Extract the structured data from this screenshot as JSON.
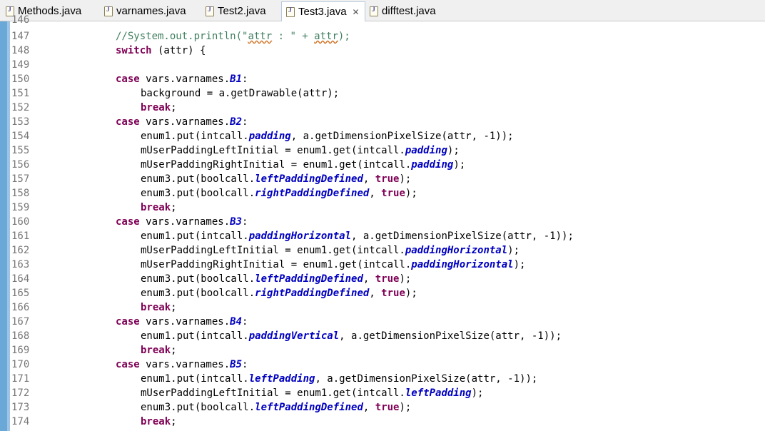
{
  "tabs": [
    {
      "label": "Methods.java",
      "active": false
    },
    {
      "label": "varnames.java",
      "active": false
    },
    {
      "label": "Test2.java",
      "active": false
    },
    {
      "label": "Test3.java",
      "active": true
    },
    {
      "label": "difftest.java",
      "active": false
    }
  ],
  "editor": {
    "first_line_partial": "146",
    "line_numbers": [
      "147",
      "148",
      "149",
      "150",
      "151",
      "152",
      "153",
      "154",
      "155",
      "156",
      "157",
      "158",
      "159",
      "160",
      "161",
      "162",
      "163",
      "164",
      "165",
      "166",
      "167",
      "168",
      "169",
      "170",
      "171",
      "172",
      "173",
      "174"
    ],
    "lines": {
      "l147": {
        "c": "//System.out.println(\"",
        "sq1": "attr",
        "m": " : \" + ",
        "sq2": "attr",
        "e": ");"
      },
      "l148": {
        "k": "switch",
        "t": " (attr) {"
      },
      "l150": {
        "k": "case",
        "t": " vars.varnames.",
        "f": "B1",
        "e": ":"
      },
      "l151": {
        "t": "background = a.getDrawable(attr);"
      },
      "l152": {
        "k": "break",
        "e": ";"
      },
      "l153": {
        "k": "case",
        "t": " vars.varnames.",
        "f": "B2",
        "e": ":"
      },
      "l154": {
        "t": "enum1.put(intcall.",
        "f": "padding",
        "e": ", a.getDimensionPixelSize(attr, -1));"
      },
      "l155": {
        "t": "mUserPaddingLeftInitial = enum1.get(intcall.",
        "f": "padding",
        "e": ");"
      },
      "l156": {
        "t": "mUserPaddingRightInitial = enum1.get(intcall.",
        "f": "padding",
        "e": ");"
      },
      "l157": {
        "t": "enum3.put(boolcall.",
        "f": "leftPaddingDefined",
        "m": ", ",
        "k": "true",
        "e": ");"
      },
      "l158": {
        "t": "enum3.put(boolcall.",
        "f": "rightPaddingDefined",
        "m": ", ",
        "k": "true",
        "e": ");"
      },
      "l159": {
        "k": "break",
        "e": ";"
      },
      "l160": {
        "k": "case",
        "t": " vars.varnames.",
        "f": "B3",
        "e": ":"
      },
      "l161": {
        "t": "enum1.put(intcall.",
        "f": "paddingHorizontal",
        "e": ", a.getDimensionPixelSize(attr, -1));"
      },
      "l162": {
        "t": "mUserPaddingLeftInitial = enum1.get(intcall.",
        "f": "paddingHorizontal",
        "e": ");"
      },
      "l163": {
        "t": "mUserPaddingRightInitial = enum1.get(intcall.",
        "f": "paddingHorizontal",
        "e": ");"
      },
      "l164": {
        "t": "enum3.put(boolcall.",
        "f": "leftPaddingDefined",
        "m": ", ",
        "k": "true",
        "e": ");"
      },
      "l165": {
        "t": "enum3.put(boolcall.",
        "f": "rightPaddingDefined",
        "m": ", ",
        "k": "true",
        "e": ");"
      },
      "l166": {
        "k": "break",
        "e": ";"
      },
      "l167": {
        "k": "case",
        "t": " vars.varnames.",
        "f": "B4",
        "e": ":"
      },
      "l168": {
        "t": "enum1.put(intcall.",
        "f": "paddingVertical",
        "e": ", a.getDimensionPixelSize(attr, -1));"
      },
      "l169": {
        "k": "break",
        "e": ";"
      },
      "l170": {
        "k": "case",
        "t": " vars.varnames.",
        "f": "B5",
        "e": ":"
      },
      "l171": {
        "t": "enum1.put(intcall.",
        "f": "leftPadding",
        "e": ", a.getDimensionPixelSize(attr, -1));"
      },
      "l172": {
        "t": "mUserPaddingLeftInitial = enum1.get(intcall.",
        "f": "leftPadding",
        "e": ");"
      },
      "l173": {
        "t": "enum3.put(boolcall.",
        "f": "leftPaddingDefined",
        "m": ", ",
        "k": "true",
        "e": ");"
      },
      "l174": {
        "k": "break",
        "e": ";"
      }
    }
  }
}
